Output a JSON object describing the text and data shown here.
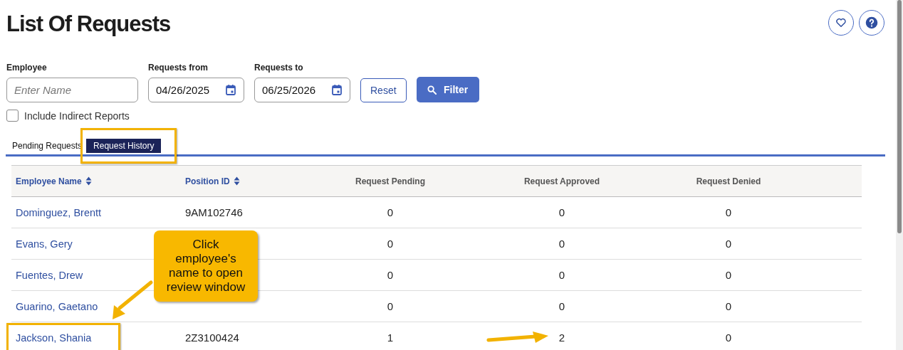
{
  "title": "List Of Requests",
  "filters": {
    "employee": {
      "label": "Employee",
      "placeholder": "Enter Name"
    },
    "from": {
      "label": "Requests from",
      "value": "04/26/2025"
    },
    "to": {
      "label": "Requests to",
      "value": "06/25/2026"
    },
    "reset": "Reset",
    "filter": "Filter",
    "include_indirect": {
      "label": "Include Indirect Reports",
      "checked": false
    }
  },
  "tabs": [
    {
      "label": "Pending Requests",
      "selected": false,
      "highlighted": false
    },
    {
      "label": "Request History",
      "selected": true,
      "highlighted": true
    }
  ],
  "table": {
    "columns": [
      {
        "label": "Employee Name",
        "sortable": true
      },
      {
        "label": "Position ID",
        "sortable": true
      },
      {
        "label": "Request Pending",
        "sortable": false
      },
      {
        "label": "Request Approved",
        "sortable": false
      },
      {
        "label": "Request Denied",
        "sortable": false
      }
    ],
    "rows": [
      {
        "employee_name": "Dominguez, Brentt",
        "position_id": "9AM102746",
        "pending": "0",
        "approved": "0",
        "denied": "0",
        "highlighted": false,
        "arrow": false
      },
      {
        "employee_name": "Evans, Gery",
        "pending": "0",
        "approved": "0",
        "denied": "0",
        "highlighted": false,
        "arrow": false
      },
      {
        "employee_name": "Fuentes, Drew",
        "pending": "0",
        "approved": "0",
        "denied": "0",
        "highlighted": false,
        "arrow": false
      },
      {
        "employee_name": "Guarino, Gaetano",
        "pending": "0",
        "approved": "0",
        "denied": "0",
        "highlighted": false,
        "arrow": false
      },
      {
        "employee_name": "Jackson, Shania",
        "position_id": "2Z3100424",
        "pending": "1",
        "approved": "2",
        "denied": "0",
        "highlighted": true,
        "arrow": true
      }
    ]
  },
  "callout": {
    "text": "Click employee's name to open review window"
  }
}
